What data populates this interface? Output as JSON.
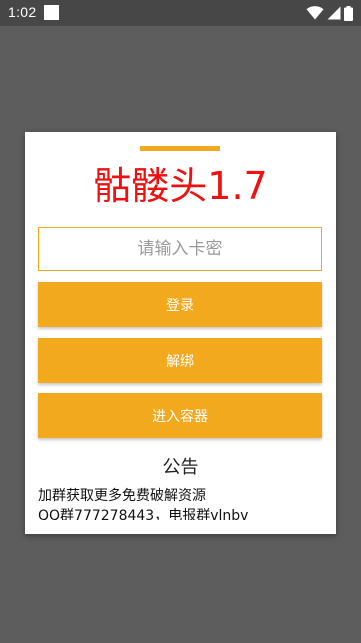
{
  "status_bar": {
    "time": "1:02",
    "icons": [
      "notification-square-icon",
      "wifi-icon",
      "cellular-signal-icon",
      "battery-icon"
    ]
  },
  "dialog": {
    "title": "骷髅头1.7",
    "key_input": {
      "placeholder": "请输入卡密",
      "value": ""
    },
    "buttons": {
      "login": "登录",
      "unbind": "解绑",
      "enter_container": "进入容器"
    },
    "notice": {
      "title": "公告",
      "lines": [
        "加群获取更多免费破解资源",
        "QQ群777278443，电报群vlnbv"
      ]
    }
  },
  "colors": {
    "accent": "#f3a91e",
    "title": "#ee1111",
    "backdrop": "#5d5d5d",
    "status_bar": "#474747"
  }
}
